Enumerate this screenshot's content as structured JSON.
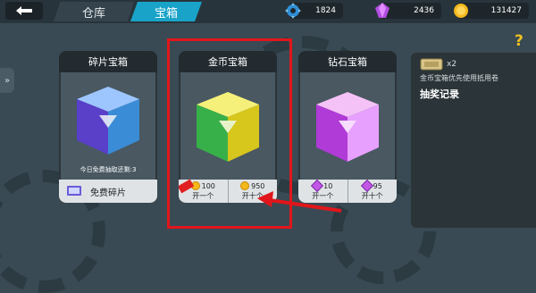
{
  "topbar": {
    "tabs": [
      {
        "label": "仓库",
        "active": false
      },
      {
        "label": "宝箱",
        "active": true
      }
    ],
    "resources": [
      {
        "icon": "gear-token-icon",
        "value": "1824"
      },
      {
        "icon": "purple-gem-icon",
        "value": "2436"
      },
      {
        "icon": "gold-coin-icon",
        "value": "131427"
      }
    ]
  },
  "chests": [
    {
      "name": "碎片宝箱",
      "free_note": "今日免费抽取还剩:3",
      "free_button": "免费碎片"
    },
    {
      "name": "金币宝箱",
      "options": [
        {
          "price": "100",
          "label": "开一个",
          "currency": "gold-coin-icon",
          "hot": true
        },
        {
          "price": "950",
          "label": "开十个",
          "currency": "gold-coin-icon"
        }
      ]
    },
    {
      "name": "钻石宝箱",
      "options": [
        {
          "price": "10",
          "label": "开一个",
          "currency": "purple-gem-icon"
        },
        {
          "price": "95",
          "label": "开十个",
          "currency": "purple-gem-icon"
        }
      ]
    }
  ],
  "info_panel": {
    "ticket_count": "x2",
    "ticket_note": "金币宝箱优先使用抵用卷",
    "draw_record_title": "抽奖记录"
  },
  "help_label": "?",
  "colors": {
    "accent_tab": "#1aa3c8",
    "highlight_box": "#e0161b",
    "coin": "#f5b81c",
    "gem": "#c257e6"
  }
}
